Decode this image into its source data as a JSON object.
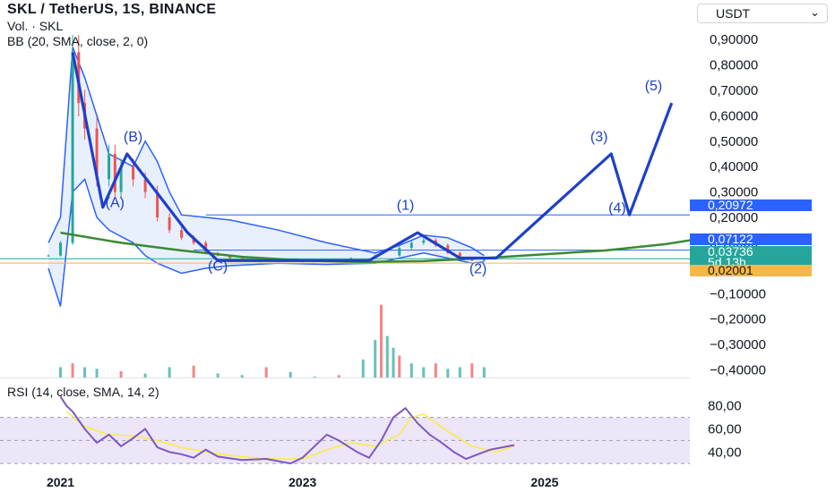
{
  "header": {
    "title": "SKL / TetherUS, 1S, BINANCE",
    "volume_label": "Vol. · SKL",
    "bb_label": "BB (20, SMA, close, 2, 0)"
  },
  "currency_button": {
    "label": "USDT",
    "icon": "chevron-down-icon"
  },
  "rsi": {
    "label": "RSI (14, close, SMA, 14, 2)"
  },
  "colors": {
    "up": "#26a69a",
    "down": "#ef5350",
    "bb": "#2962ff",
    "bb_fill": "#dbe6fb",
    "wave": "#1e40c8",
    "curve": "#3a8a35",
    "gold": "#f2b84b",
    "rsi_line": "#7e57c2",
    "rsi_ma": "#ffeb3b",
    "rsi_band": "#ece6f8"
  },
  "chart_data": [
    {
      "type": "candlestick",
      "title": "SKL / TetherUS, 1S, BINANCE",
      "y_axis_ticks": [
        "0,90000",
        "0,80000",
        "0,70000",
        "0,60000",
        "0,50000",
        "0,40000",
        "0,30000",
        "0,20000",
        "0,10000",
        "0,00000",
        "−0,10000",
        "−0,20000",
        "−0,30000",
        "−0,40000"
      ],
      "y_axis_tick_values": [
        0.9,
        0.8,
        0.7,
        0.6,
        0.5,
        0.4,
        0.3,
        0.2,
        0.1,
        0.0,
        -0.1,
        -0.2,
        -0.3,
        -0.4
      ],
      "ylim": [
        -0.43,
        0.95
      ],
      "x_axis_ticks": [
        "2021",
        "2023",
        "2025"
      ],
      "x_axis_tick_values": [
        2021.0,
        2023.0,
        2025.0
      ],
      "xlim": [
        2020.5,
        2026.2
      ],
      "price_labels": [
        {
          "text": "0,20972",
          "value": 0.20972,
          "color": "#2962ff"
        },
        {
          "text": "0,07122",
          "value": 0.07122,
          "color": "#2962ff"
        },
        {
          "text": "0,03736",
          "value": 0.03736,
          "color": "#26a69a"
        },
        {
          "text": "5d 13h",
          "value": 0.012,
          "color": "#26a69a"
        },
        {
          "text": "0,02001",
          "value": 0.02001,
          "color": "#f2b84b"
        }
      ],
      "series": [
        {
          "name": "",
          "kind": "close",
          "x": [
            2020.9,
            2021.0,
            2021.1,
            2021.15,
            2021.2,
            2021.3,
            2021.4,
            2021.45,
            2021.5,
            2021.6,
            2021.7,
            2021.8,
            2021.9,
            2022.0,
            2022.1,
            2022.2,
            2022.3,
            2022.4,
            2022.5,
            2022.6,
            2022.8,
            2023.0,
            2023.2,
            2023.4,
            2023.6,
            2023.8,
            2023.9,
            2024.0,
            2024.1,
            2024.2,
            2024.3,
            2024.4,
            2024.5
          ],
          "y": [
            0.05,
            0.1,
            0.85,
            0.65,
            0.55,
            0.35,
            0.45,
            0.3,
            0.4,
            0.35,
            0.3,
            0.2,
            0.15,
            0.12,
            0.1,
            0.06,
            0.05,
            0.04,
            0.035,
            0.03,
            0.03,
            0.025,
            0.03,
            0.04,
            0.05,
            0.08,
            0.1,
            0.11,
            0.09,
            0.06,
            0.04,
            0.03,
            0.035
          ]
        }
      ],
      "bollinger_bands": {
        "upper": {
          "x": [
            2020.9,
            2021.0,
            2021.1,
            2021.2,
            2021.3,
            2021.4,
            2021.6,
            2021.7,
            2021.8,
            2021.9,
            2022.0,
            2022.2,
            2022.4,
            2022.8,
            2023.2,
            2023.6,
            2023.8,
            2024.0,
            2024.2,
            2024.4,
            2024.5
          ],
          "y": [
            0.1,
            0.2,
            0.87,
            0.75,
            0.6,
            0.45,
            0.4,
            0.5,
            0.42,
            0.3,
            0.21,
            0.2,
            0.19,
            0.15,
            0.1,
            0.06,
            0.09,
            0.13,
            0.12,
            0.08,
            0.05
          ]
        },
        "lower": {
          "x": [
            2020.9,
            2021.0,
            2021.1,
            2021.2,
            2021.3,
            2021.4,
            2021.6,
            2021.7,
            2021.8,
            2021.9,
            2022.0,
            2022.2,
            2022.4,
            2022.8,
            2023.2,
            2023.6,
            2023.8,
            2024.0,
            2024.2,
            2024.4,
            2024.5
          ],
          "y": [
            0.0,
            -0.15,
            0.3,
            0.35,
            0.2,
            0.15,
            0.1,
            0.05,
            0.02,
            0.0,
            -0.02,
            0.0,
            0.01,
            0.02,
            0.015,
            0.02,
            0.04,
            0.06,
            0.04,
            0.02,
            0.025
          ]
        }
      },
      "horizontal_levels": [
        {
          "value": 0.20972,
          "color": "#2962ff"
        },
        {
          "value": 0.07122,
          "color": "#2962ff"
        },
        {
          "value": 0.03736,
          "color": "#26a69a"
        },
        {
          "value": 0.02001,
          "color": "#f2b84b"
        }
      ],
      "wave_annotations": [
        {
          "label": "(A)",
          "x": 2021.45,
          "y": 0.24
        },
        {
          "label": "(B)",
          "x": 2021.6,
          "y": 0.5
        },
        {
          "label": "(C)",
          "x": 2022.3,
          "y": -0.01
        },
        {
          "label": "(1)",
          "x": 2023.85,
          "y": 0.23
        },
        {
          "label": "(2)",
          "x": 2024.45,
          "y": -0.02
        },
        {
          "label": "(3)",
          "x": 2025.45,
          "y": 0.5
        },
        {
          "label": "(4)",
          "x": 2025.6,
          "y": 0.22
        },
        {
          "label": "(5)",
          "x": 2025.9,
          "y": 0.7
        }
      ],
      "wave_path": {
        "x": [
          2021.1,
          2021.35,
          2021.55,
          2022.05,
          2022.3,
          2022.9,
          2023.55,
          2023.95,
          2024.3,
          2024.6,
          2025.55,
          2025.7,
          2026.05
        ],
        "y": [
          0.85,
          0.24,
          0.45,
          0.14,
          0.03,
          0.03,
          0.03,
          0.14,
          0.04,
          0.04,
          0.45,
          0.21,
          0.65
        ]
      },
      "curve": {
        "x": [
          2021.0,
          2021.5,
          2022.0,
          2022.5,
          2023.0,
          2023.5,
          2024.0,
          2024.5,
          2025.0,
          2025.5,
          2026.0,
          2026.2
        ],
        "y": [
          0.14,
          0.1,
          0.07,
          0.045,
          0.03,
          0.025,
          0.028,
          0.04,
          0.055,
          0.07,
          0.095,
          0.11
        ]
      }
    },
    {
      "type": "bar",
      "name": "Vol. · SKL",
      "x": [
        2021.0,
        2021.1,
        2021.2,
        2021.3,
        2021.5,
        2021.7,
        2021.9,
        2022.1,
        2022.3,
        2022.5,
        2022.7,
        2022.9,
        2023.1,
        2023.3,
        2023.5,
        2023.6,
        2023.65,
        2023.7,
        2023.75,
        2023.8,
        2023.9,
        2024.0,
        2024.1,
        2024.2,
        2024.3,
        2024.4,
        2024.5
      ],
      "values": [
        0.2,
        0.25,
        0.2,
        0.18,
        0.15,
        0.12,
        0.2,
        0.22,
        0.12,
        0.1,
        0.2,
        0.14,
        0.08,
        0.1,
        0.3,
        0.55,
        1.0,
        0.6,
        0.45,
        0.35,
        0.25,
        0.2,
        0.25,
        0.18,
        0.2,
        0.25,
        0.2
      ],
      "ylim": [
        0,
        1.1
      ]
    },
    {
      "type": "line",
      "name": "RSI (14, close, SMA, 14, 2)",
      "y_axis_ticks": [
        "80,00",
        "60,00",
        "40,00"
      ],
      "y_axis_tick_values": [
        80,
        60,
        40
      ],
      "ylim": [
        27,
        86
      ],
      "band": [
        30,
        70
      ],
      "series": [
        {
          "name": "",
          "x": [
            2021.0,
            2021.05,
            2021.1,
            2021.2,
            2021.3,
            2021.4,
            2021.5,
            2021.6,
            2021.7,
            2021.8,
            2021.9,
            2022.0,
            2022.1,
            2022.2,
            2022.3,
            2022.5,
            2022.7,
            2022.9,
            2023.0,
            2023.1,
            2023.2,
            2023.3,
            2023.45,
            2023.55,
            2023.65,
            2023.75,
            2023.85,
            2023.95,
            2024.05,
            2024.15,
            2024.25,
            2024.35,
            2024.45,
            2024.55,
            2024.65,
            2024.75
          ],
          "y": [
            88,
            80,
            75,
            60,
            48,
            55,
            45,
            52,
            60,
            44,
            40,
            38,
            35,
            42,
            36,
            33,
            34,
            30,
            35,
            45,
            55,
            50,
            40,
            35,
            50,
            70,
            78,
            65,
            55,
            48,
            40,
            34,
            38,
            42,
            44,
            46
          ]
        },
        {
          "name": "",
          "x": [
            2021.05,
            2021.2,
            2021.4,
            2021.6,
            2021.8,
            2022.0,
            2022.2,
            2022.4,
            2022.6,
            2022.8,
            2023.0,
            2023.2,
            2023.4,
            2023.6,
            2023.8,
            2023.9,
            2024.0,
            2024.2,
            2024.4,
            2024.6,
            2024.75
          ],
          "y": [
            75,
            62,
            55,
            54,
            50,
            44,
            40,
            37,
            35,
            34,
            34,
            42,
            48,
            45,
            55,
            70,
            73,
            58,
            45,
            40,
            45
          ]
        }
      ]
    }
  ]
}
